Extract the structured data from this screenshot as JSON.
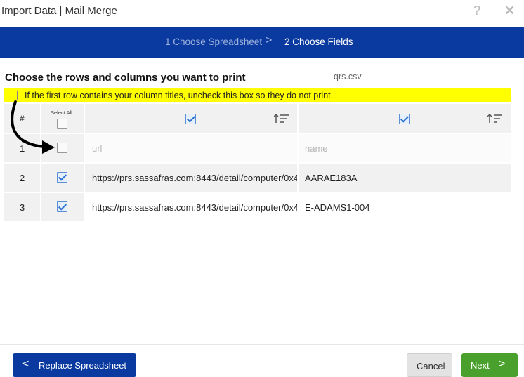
{
  "window": {
    "title": "Import Data | Mail Merge",
    "help_glyph": "?",
    "close_glyph": "✕"
  },
  "steps": {
    "step1": "1 Choose Spreadsheet",
    "separator": ">",
    "step2": "2 Choose Fields"
  },
  "main": {
    "heading": "Choose the rows and columns you want to print",
    "filename": "qrs.csv",
    "first_row_notice": "If the first row contains your column titles, uncheck this box so they do not print.",
    "first_row_checked": false
  },
  "table": {
    "header_num": "#",
    "select_all_label": "Select All",
    "select_all_checked": false,
    "columns": [
      {
        "checked": true,
        "sort_icon": "sort-ascending-icon"
      },
      {
        "checked": true,
        "sort_icon": "sort-ascending-icon"
      }
    ],
    "rows": [
      {
        "num": "1",
        "checked": false,
        "cells": [
          "url",
          "name"
        ],
        "placeholder": true
      },
      {
        "num": "2",
        "checked": true,
        "cells": [
          "https://prs.sassafras.com:8443/detail/computer/0x4",
          "AARAE183A"
        ],
        "placeholder": false
      },
      {
        "num": "3",
        "checked": true,
        "cells": [
          "https://prs.sassafras.com:8443/detail/computer/0x4",
          "E-ADAMS1-004"
        ],
        "placeholder": false
      }
    ]
  },
  "footer": {
    "replace_label": "Replace Spreadsheet",
    "cancel_label": "Cancel",
    "next_label": "Next",
    "back_glyph": "<",
    "next_glyph": ">"
  },
  "colors": {
    "brand_blue": "#0a3aa0",
    "next_green": "#4aa02c",
    "highlight_yellow": "#ffff00"
  }
}
